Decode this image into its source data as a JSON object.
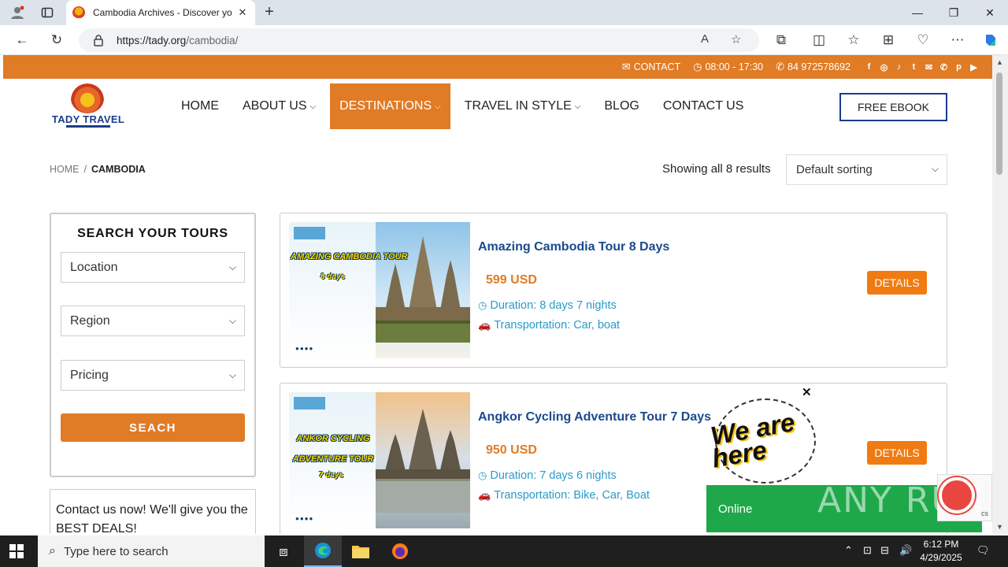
{
  "browser": {
    "tab_title": "Cambodia Archives - Discover yo",
    "url_host": "https://tady.org",
    "url_path": "/cambodia/"
  },
  "topbar": {
    "contact": "CONTACT",
    "hours": "08:00 - 17:30",
    "phone": "84 972578692",
    "socials": [
      "f",
      "◎",
      "♪",
      "t",
      "✉",
      "✆",
      "p",
      "▶"
    ]
  },
  "logo": {
    "brand": "TADY TRAVEL"
  },
  "menu": {
    "items": [
      {
        "label": "HOME"
      },
      {
        "label": "ABOUT US"
      },
      {
        "label": "DESTINATIONS"
      },
      {
        "label": "TRAVEL IN STYLE"
      },
      {
        "label": "BLOG"
      },
      {
        "label": "CONTACT US"
      }
    ],
    "ebook": "FREE EBOOK"
  },
  "breadcrumb": {
    "home": "HOME",
    "sep": "/",
    "current": "CAMBODIA"
  },
  "results": {
    "text": "Showing all 8 results",
    "sort": "Default sorting"
  },
  "sidebar": {
    "title": "SEARCH YOUR TOURS",
    "location": "Location",
    "region": "Region",
    "pricing": "Pricing",
    "search": "SEACH",
    "contact_text": "Contact us now! We'll give you the BEST DEALS!"
  },
  "tours": [
    {
      "title": "Amazing Cambodia Tour 8 Days",
      "price": "599 USD",
      "duration": "Duration: 8 days 7 nights",
      "transport": "Transportation: Car, boat",
      "details": "DETAILS",
      "thumb_caption": "AMAZING CAMBODIA TOUR",
      "thumb_days": "8 days"
    },
    {
      "title": "Angkor Cycling Adventure Tour 7 Days",
      "price": "950 USD",
      "duration": "Duration: 7 days 6 nights",
      "transport": "Transportation: Bike, Car, Boat",
      "details": "DETAILS",
      "thumb_caption": "ANKOR CYCLING ADVENTURE TOUR",
      "thumb_days": "7 days"
    }
  ],
  "chat": {
    "line1": "We are",
    "line2": "here",
    "status": "Online"
  },
  "watermark": "ANY RUN",
  "taskbar": {
    "search_placeholder": "Type here to search",
    "time": "6:12 PM",
    "date": "4/29/2025"
  },
  "colors": {
    "accent": "#e07b26",
    "link": "#1b4a8c",
    "info": "#2a9bc8"
  }
}
